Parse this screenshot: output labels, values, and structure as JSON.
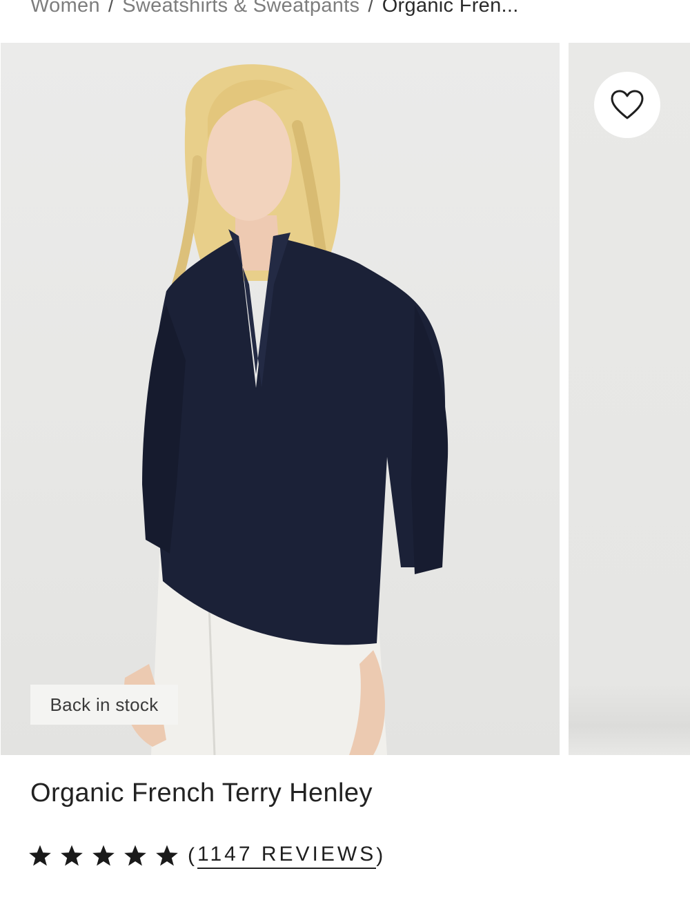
{
  "breadcrumb": {
    "items": [
      "Women",
      "Sweatshirts & Sweatpants"
    ],
    "separator": "/",
    "current": "Organic Fren..."
  },
  "gallery": {
    "badge": "Back in stock",
    "wishlist_icon": "heart-outline-icon"
  },
  "product": {
    "title": "Organic French Terry Henley",
    "rating_stars": 5,
    "reviews_open": "(",
    "reviews_label": "1147 REVIEWS",
    "reviews_close": ")"
  },
  "colors": {
    "sweater": "#1b2137",
    "background": "#e8e8e6",
    "text": "#1f1f1f"
  }
}
